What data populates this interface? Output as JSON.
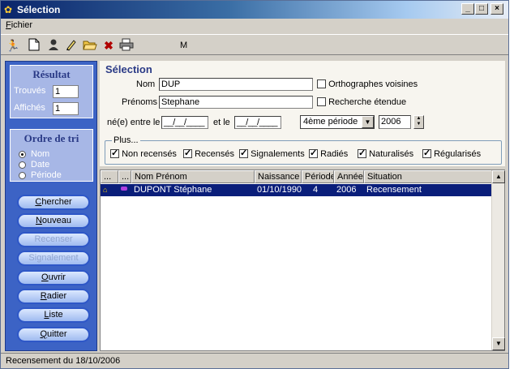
{
  "window": {
    "title": "Sélection",
    "min": "_",
    "max": "□",
    "close": "×"
  },
  "menu": {
    "fichier_first": "F",
    "fichier_rest": "ichier"
  },
  "toolbar": {
    "label_m": "M",
    "icons": [
      "running-man-icon",
      "new-document-icon",
      "person-icon",
      "edit-icon",
      "open-folder-icon",
      "delete-x-icon",
      "printer-icon"
    ]
  },
  "result": {
    "title": "Résultat",
    "trouves_label": "Trouvés",
    "trouves_value": "1",
    "affiches_label": "Affichés",
    "affiches_value": "1"
  },
  "sort": {
    "title": "Ordre de tri",
    "options": [
      {
        "label": "Nom",
        "selected": true
      },
      {
        "label": "Date",
        "selected": false
      },
      {
        "label": "Période",
        "selected": false
      }
    ]
  },
  "buttons": {
    "chercher_u": "C",
    "chercher": "hercher",
    "nouveau_u": "N",
    "nouveau": "ouveau",
    "recenser": "Recenser",
    "signalement": "Signalement",
    "ouvrir_u": "O",
    "ouvrir": "uvrir",
    "radier_u": "R",
    "radier": "adier",
    "liste_u": "L",
    "liste": "iste",
    "quitter_u": "Q",
    "quitter": "uitter"
  },
  "selection": {
    "title": "Sélection",
    "nom_label": "Nom",
    "nom_value": "DUP",
    "prenoms_label": "Prénoms",
    "prenoms_value": "Stephane",
    "ortho_label": "Orthographes voisines",
    "recherche_label": "Recherche étendue",
    "ne_label": "né(e) entre le",
    "date1": "__/__/____",
    "et_label": "et le",
    "date2": "__/__/____",
    "periode_value": "4ème période",
    "annee_value": "2006"
  },
  "plus": {
    "label": "Plus...",
    "checks": [
      {
        "label": "Non recensés",
        "checked": true
      },
      {
        "label": "Recensés",
        "checked": true
      },
      {
        "label": "Signalements",
        "checked": true
      },
      {
        "label": "Radiés",
        "checked": true
      },
      {
        "label": "Naturalisés",
        "checked": true
      },
      {
        "label": "Régularisés",
        "checked": true
      }
    ]
  },
  "grid": {
    "headers": [
      "...",
      "...",
      "Nom Prénom",
      "Naissance",
      "Période",
      "Année",
      "Situation"
    ],
    "rows": [
      {
        "name": "DUPONT Stéphane",
        "naissance": "01/10/1990",
        "periode": "4",
        "annee": "2006",
        "situation": "Recensement"
      }
    ]
  },
  "status": "Recensement du 18/10/2006",
  "colors": {
    "accent": "#3c63c5",
    "selection_row": "#0a1e7a",
    "title_blue": "#2a3a86"
  }
}
